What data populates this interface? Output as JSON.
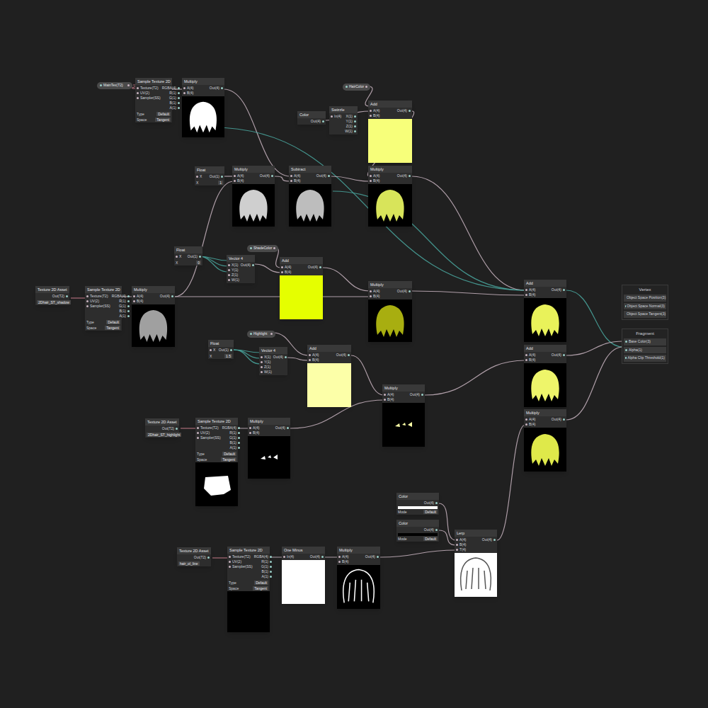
{
  "graph": {
    "nodes": [
      {
        "kind": "property",
        "title": "MainTex(T2)"
      },
      {
        "kind": "node",
        "title": "Sample Texture 2D",
        "inputs": [
          "Texture(T2)",
          "UV(2)",
          "Sampler(SS)"
        ],
        "outputs": [
          "RGBA(4)",
          "R(1)",
          "G(1)",
          "B(1)",
          "A(1)"
        ],
        "fields": [
          {
            "label": "Type",
            "value": "Default"
          },
          {
            "label": "Space",
            "value": "Tangent"
          }
        ]
      },
      {
        "kind": "node",
        "title": "Multiply",
        "inputs": [
          "A(4)",
          "B(4)"
        ],
        "outputs": [
          "Out(4)"
        ],
        "preview": {
          "shape": "hair",
          "bg": "#000000",
          "fg": "#ffffff"
        }
      },
      {
        "kind": "node",
        "title": "Color",
        "inputs": [],
        "outputs": [
          "Out(4)"
        ]
      },
      {
        "kind": "node",
        "title": "Swizzle",
        "inputs": [
          "In(4)"
        ],
        "outputs": [
          "X(1)",
          "Y(1)",
          "Z(1)",
          "W(1)"
        ]
      },
      {
        "kind": "property",
        "title": "HairColor"
      },
      {
        "kind": "node",
        "title": "Add",
        "inputs": [
          "A(4)",
          "B(4)"
        ],
        "outputs": [
          "Out(4)"
        ],
        "preview": {
          "shape": "fill",
          "bg": "#f7ff7a",
          "fg": "#f7ff7a"
        }
      },
      {
        "kind": "node",
        "title": "Float",
        "inputs": [
          "X"
        ],
        "outputs": [
          "Out(1)"
        ],
        "fields": [
          {
            "label": "X",
            "value": "1"
          }
        ]
      },
      {
        "kind": "node",
        "title": "Multiply",
        "inputs": [
          "A(4)",
          "B(4)"
        ],
        "outputs": [
          "Out(4)"
        ],
        "preview": {
          "shape": "hair",
          "bg": "#000000",
          "fg": "#cfcfcf"
        }
      },
      {
        "kind": "node",
        "title": "Subtract",
        "inputs": [
          "A(4)",
          "B(4)"
        ],
        "outputs": [
          "Out(4)"
        ],
        "preview": {
          "shape": "hair",
          "bg": "#000000",
          "fg": "#bdbdbd"
        }
      },
      {
        "kind": "node",
        "title": "Multiply",
        "inputs": [
          "A(4)",
          "B(4)"
        ],
        "outputs": [
          "Out(4)"
        ],
        "preview": {
          "shape": "hair",
          "bg": "#000000",
          "fg": "#d8e45a"
        }
      },
      {
        "kind": "node",
        "title": "Float",
        "inputs": [
          "X"
        ],
        "outputs": [
          "Out(1)"
        ],
        "fields": [
          {
            "label": "X",
            "value": "0"
          }
        ]
      },
      {
        "kind": "node",
        "title": "Vector 4",
        "inputs": [
          "X(1)",
          "Y(1)",
          "Z(1)",
          "W(1)"
        ],
        "outputs": [
          "Out(4)"
        ]
      },
      {
        "kind": "property",
        "title": "ShadeColor"
      },
      {
        "kind": "node",
        "title": "Add",
        "inputs": [
          "A(4)",
          "B(4)"
        ],
        "outputs": [
          "Out(4)"
        ],
        "preview": {
          "shape": "fill",
          "bg": "#e5ff00",
          "fg": "#e5ff00"
        }
      },
      {
        "kind": "node",
        "title": "Multiply",
        "inputs": [
          "A(4)",
          "B(4)"
        ],
        "outputs": [
          "Out(4)"
        ],
        "preview": {
          "shape": "hair",
          "bg": "#000000",
          "fg": "#a8ae10"
        }
      },
      {
        "kind": "asset",
        "title": "Texture 2D Asset",
        "inputs": [],
        "outputs": [
          "Out(T2)"
        ],
        "fields": [
          {
            "label": "",
            "value": "2Dhair_ST_shadow"
          }
        ]
      },
      {
        "kind": "node",
        "title": "Sample Texture 2D",
        "inputs": [
          "Texture(T2)",
          "UV(2)",
          "Sampler(SS)"
        ],
        "outputs": [
          "RGBA(4)",
          "R(1)",
          "G(1)",
          "B(1)",
          "A(1)"
        ],
        "fields": [
          {
            "label": "Type",
            "value": "Default"
          },
          {
            "label": "Space",
            "value": "Tangent"
          }
        ]
      },
      {
        "kind": "node",
        "title": "Multiply",
        "inputs": [
          "A(4)",
          "B(4)"
        ],
        "outputs": [
          "Out(4)"
        ],
        "preview": {
          "shape": "hair",
          "bg": "#000000",
          "fg": "#a0a0a0"
        }
      },
      {
        "kind": "node",
        "title": "Add",
        "inputs": [
          "A(4)",
          "B(4)"
        ],
        "outputs": [
          "Out(4)"
        ],
        "preview": {
          "shape": "hair",
          "bg": "#000000",
          "fg": "#e9f25a"
        }
      },
      {
        "kind": "master",
        "title": "Vertex",
        "inputs": [
          "Object Space Position(3)",
          "Object Space Normal(3)",
          "Object Space Tangent(3)"
        ]
      },
      {
        "kind": "master",
        "title": "Fragment",
        "inputs": [
          "Base Color(3)",
          "Alpha(1)",
          "Alpha Clip Threshold(1)"
        ]
      },
      {
        "kind": "property",
        "title": "Highlight"
      },
      {
        "kind": "node",
        "title": "Float",
        "inputs": [
          "X"
        ],
        "outputs": [
          "Out(1)"
        ],
        "fields": [
          {
            "label": "X",
            "value": "1.5"
          }
        ]
      },
      {
        "kind": "node",
        "title": "Vector 4",
        "inputs": [
          "X(1)",
          "Y(1)",
          "Z(1)",
          "W(1)"
        ],
        "outputs": [
          "Out(4)"
        ]
      },
      {
        "kind": "node",
        "title": "Add",
        "inputs": [
          "A(4)",
          "B(4)"
        ],
        "outputs": [
          "Out(4)"
        ],
        "preview": {
          "shape": "fill",
          "bg": "#fcffa8",
          "fg": "#fcffa8"
        }
      },
      {
        "kind": "node",
        "title": "Multiply",
        "inputs": [
          "A(4)",
          "B(4)"
        ],
        "outputs": [
          "Out(4)"
        ],
        "preview": {
          "shape": "spots",
          "bg": "#000000",
          "fg": "#fcffa8"
        }
      },
      {
        "kind": "node",
        "title": "Add",
        "inputs": [
          "A(4)",
          "B(4)"
        ],
        "outputs": [
          "Out(4)"
        ],
        "preview": {
          "shape": "hair",
          "bg": "#000000",
          "fg": "#eef56a"
        }
      },
      {
        "kind": "node",
        "title": "Multiply",
        "inputs": [
          "A(4)",
          "B(4)"
        ],
        "outputs": [
          "Out(4)"
        ],
        "preview": {
          "shape": "hair",
          "bg": "#000000",
          "fg": "#dfe94a"
        }
      },
      {
        "kind": "asset",
        "title": "Texture 2D Asset",
        "inputs": [],
        "outputs": [
          "Out(T2)"
        ],
        "fields": [
          {
            "label": "",
            "value": "2Dhair_ST_highlight"
          }
        ]
      },
      {
        "kind": "node",
        "title": "Sample Texture 2D",
        "inputs": [
          "Texture(T2)",
          "UV(2)",
          "Sampler(SS)"
        ],
        "outputs": [
          "RGBA(4)",
          "R(1)",
          "G(1)",
          "B(1)",
          "A(1)"
        ],
        "fields": [
          {
            "label": "Type",
            "value": "Default"
          },
          {
            "label": "Space",
            "value": "Tangent"
          }
        ],
        "preview": {
          "shape": "blob",
          "bg": "#000000",
          "fg": "#ffffff"
        }
      },
      {
        "kind": "node",
        "title": "Multiply",
        "inputs": [
          "A(4)",
          "B(4)"
        ],
        "outputs": [
          "Out(4)"
        ],
        "preview": {
          "shape": "spots",
          "bg": "#000000",
          "fg": "#ffffff"
        }
      },
      {
        "kind": "node",
        "title": "Color",
        "inputs": [],
        "outputs": [
          "Out(4)"
        ],
        "fields": [
          {
            "label": "Mode",
            "value": "Default"
          }
        ],
        "swatch": "#ffffff"
      },
      {
        "kind": "node",
        "title": "Color",
        "inputs": [],
        "outputs": [
          "Out(4)"
        ],
        "fields": [
          {
            "label": "Mode",
            "value": "Default"
          }
        ],
        "swatch": "#000000"
      },
      {
        "kind": "node",
        "title": "Lerp",
        "inputs": [
          "A(4)",
          "B(4)",
          "T(4)"
        ],
        "outputs": [
          "Out(4)"
        ],
        "preview": {
          "shape": "outline",
          "bg": "#ffffff",
          "fg": "#555555"
        }
      },
      {
        "kind": "asset",
        "title": "Texture 2D Asset",
        "inputs": [],
        "outputs": [
          "Out(T2)"
        ],
        "fields": [
          {
            "label": "",
            "value": "hair_ol_line"
          }
        ]
      },
      {
        "kind": "node",
        "title": "Sample Texture 2D",
        "inputs": [
          "Texture(T2)",
          "UV(2)",
          "Sampler(SS)"
        ],
        "outputs": [
          "RGBA(4)",
          "R(1)",
          "G(1)",
          "B(1)",
          "A(1)"
        ],
        "fields": [
          {
            "label": "Type",
            "value": "Default"
          },
          {
            "label": "Space",
            "value": "Tangent"
          }
        ],
        "preview": {
          "shape": "fill",
          "bg": "#000000",
          "fg": "#000000"
        }
      },
      {
        "kind": "node",
        "title": "One Minus",
        "inputs": [
          "In(4)"
        ],
        "outputs": [
          "Out(4)"
        ],
        "preview": {
          "shape": "fill",
          "bg": "#ffffff",
          "fg": "#ffffff"
        }
      },
      {
        "kind": "node",
        "title": "Multiply",
        "inputs": [
          "A(4)",
          "B(4)"
        ],
        "outputs": [
          "Out(4)"
        ],
        "preview": {
          "shape": "outline",
          "bg": "#000000",
          "fg": "#ffffff"
        }
      }
    ]
  }
}
